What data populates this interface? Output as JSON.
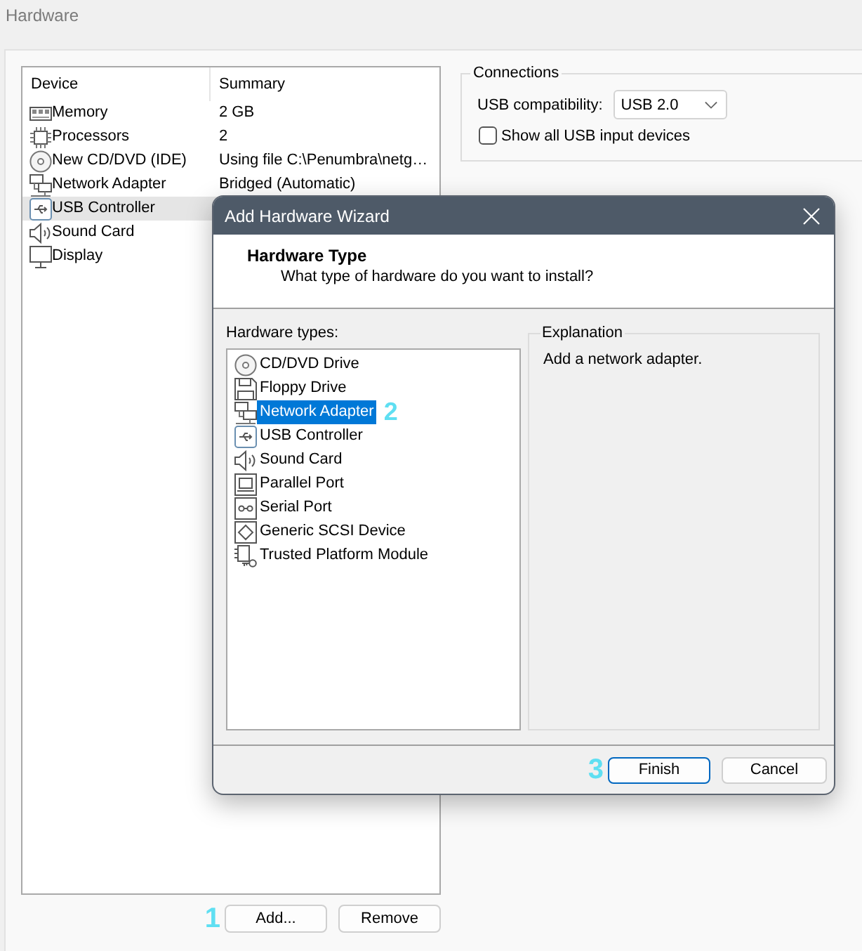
{
  "window": {
    "title": "Hardware"
  },
  "device_table": {
    "columns": [
      "Device",
      "Summary"
    ],
    "rows": [
      {
        "kind": "memory",
        "device": "Memory",
        "summary": "2 GB",
        "selected": false
      },
      {
        "kind": "processor",
        "device": "Processors",
        "summary": "2",
        "selected": false
      },
      {
        "kind": "cd",
        "device": "New CD/DVD (IDE)",
        "summary": "Using file C:\\Penumbra\\netg…",
        "selected": false
      },
      {
        "kind": "network",
        "device": "Network Adapter",
        "summary": "Bridged (Automatic)",
        "selected": false
      },
      {
        "kind": "usb",
        "device": "USB Controller",
        "selected": true
      },
      {
        "kind": "sound",
        "device": "Sound Card",
        "selected": false
      },
      {
        "kind": "display",
        "device": "Display",
        "selected": false
      }
    ]
  },
  "device_buttons": [
    {
      "label": "Add...",
      "step": "1"
    },
    {
      "label": "Remove"
    }
  ],
  "connections": {
    "title": "Connections",
    "usb_compatibility": {
      "label": "USB compatibility:",
      "value": "USB 2.0"
    },
    "show_all_usb_input_devices": {
      "label": "Show all USB input devices",
      "checked": false
    }
  },
  "dialog": {
    "title": "Add Hardware Wizard",
    "heading": "Hardware Type",
    "subheading": "What type of hardware do you want to install?",
    "list_label": "Hardware types:",
    "hardware_types": [
      {
        "kind": "cd",
        "label": "CD/DVD Drive",
        "selected": false
      },
      {
        "kind": "floppy",
        "label": "Floppy Drive",
        "selected": false
      },
      {
        "kind": "network",
        "label": "Network Adapter",
        "selected": true,
        "step": "2"
      },
      {
        "kind": "usb",
        "label": "USB Controller",
        "selected": false
      },
      {
        "kind": "sound",
        "label": "Sound Card",
        "selected": false
      },
      {
        "kind": "parallel",
        "label": "Parallel Port",
        "selected": false
      },
      {
        "kind": "serial",
        "label": "Serial Port",
        "selected": false
      },
      {
        "kind": "scsi",
        "label": "Generic SCSI Device",
        "selected": false
      },
      {
        "kind": "tpm",
        "label": "Trusted Platform Module",
        "selected": false
      }
    ],
    "explanation": {
      "title": "Explanation",
      "text": "Add a network adapter."
    },
    "buttons": [
      {
        "label": "Finish",
        "default": true,
        "step": "3"
      },
      {
        "label": "Cancel",
        "default": false
      }
    ]
  }
}
